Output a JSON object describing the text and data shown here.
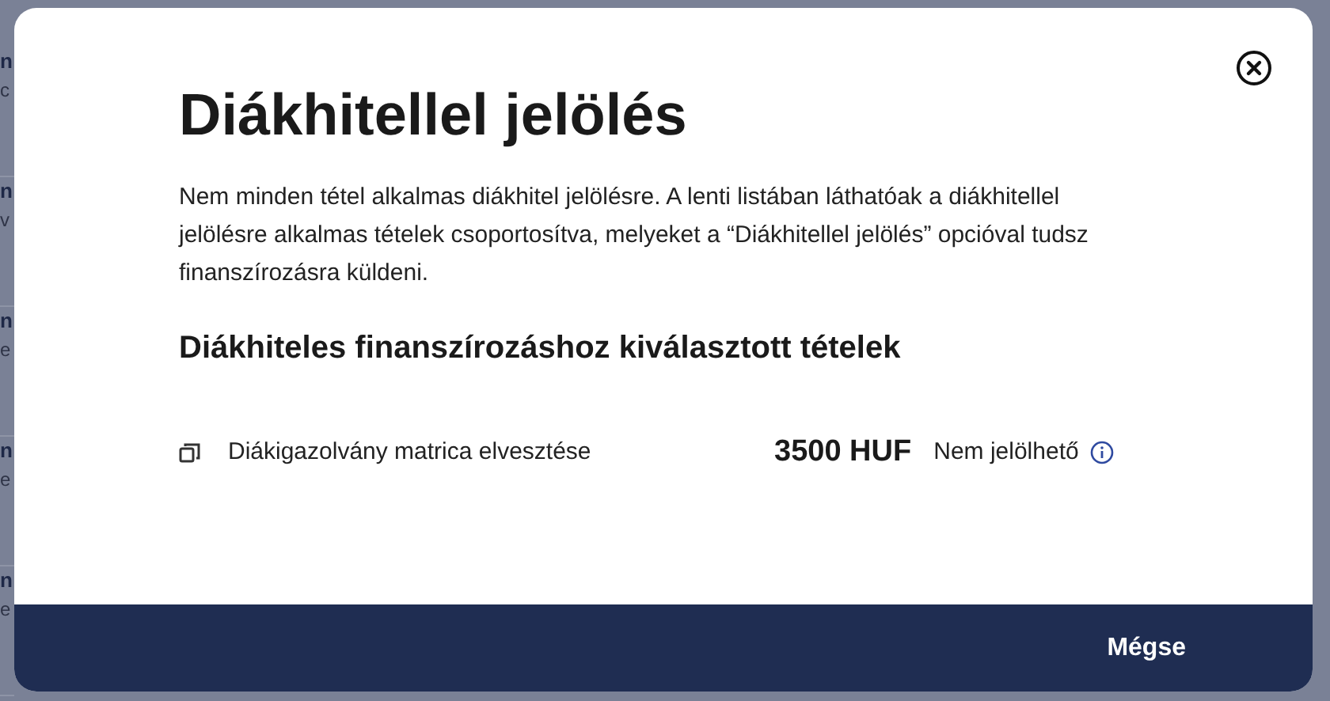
{
  "background_items": [
    {
      "title": "n",
      "subtitle": "c"
    },
    {
      "title": "n",
      "subtitle": "v"
    },
    {
      "title": "n",
      "subtitle": "e"
    },
    {
      "title": "n",
      "subtitle": "e"
    },
    {
      "title": "n",
      "subtitle": "e"
    }
  ],
  "modal": {
    "title": "Diákhitellel jelölés",
    "description": "Nem minden tétel alkalmas diákhitel jelölésre. A lenti listában láthatóak a diákhitellel jelölésre alkalmas tételek csoportosítva, melyeket a “Diákhitellel jelölés” opcióval tudsz finanszírozásra küldeni.",
    "section_title": "Diákhiteles finanszírozáshoz kiválasztott tételek",
    "items": [
      {
        "name": "Diákigazolvány matrica elvesztése",
        "amount": "3500 HUF",
        "status": "Nem jelölhető"
      }
    ],
    "footer_buttons": [
      "Mégse"
    ]
  }
}
